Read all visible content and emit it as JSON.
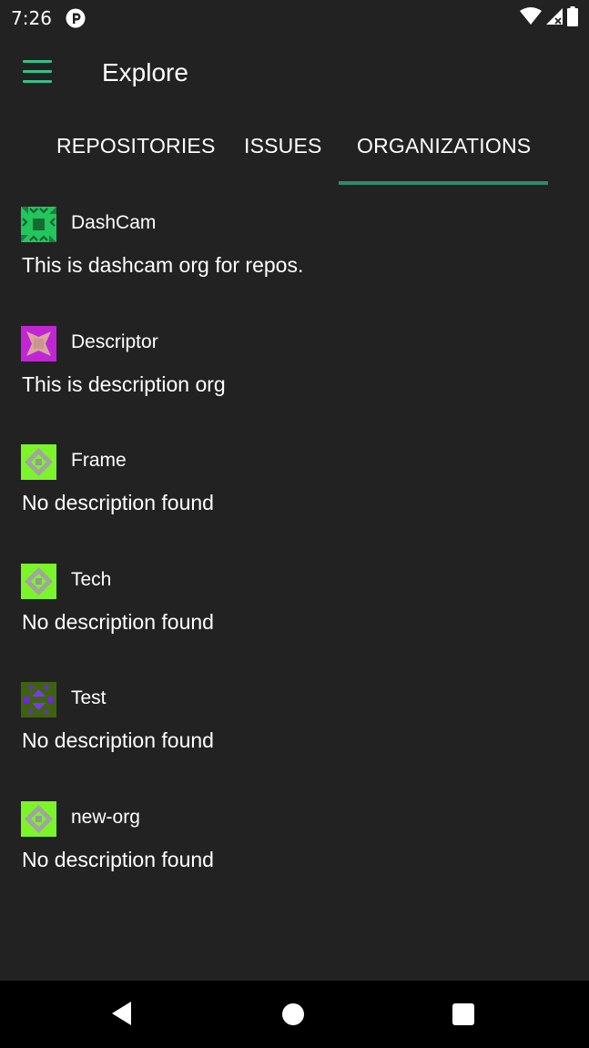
{
  "status_bar": {
    "time": "7:26",
    "app_icon": "pinterest-like-icon",
    "icons": [
      "wifi-icon",
      "signal-icon",
      "battery-icon"
    ]
  },
  "app_bar": {
    "menu_icon": "hamburger-menu-icon",
    "title": "Explore"
  },
  "tabs": [
    {
      "label": "REPOSITORIES",
      "selected": false
    },
    {
      "label": "ISSUES",
      "selected": false
    },
    {
      "label": "ORGANIZATIONS",
      "selected": true
    }
  ],
  "colors": {
    "accent": "#35c08a",
    "indicator": "#2e8b6a",
    "background": "#222222"
  },
  "organizations": [
    {
      "name": "DashCam",
      "description": "This is dashcam org for repos.",
      "avatar": "identicon-green"
    },
    {
      "name": "Descriptor",
      "description": "This is description org",
      "avatar": "identicon-magenta"
    },
    {
      "name": "Frame",
      "description": "No description found",
      "avatar": "identicon-lime"
    },
    {
      "name": "Tech",
      "description": "No description found",
      "avatar": "identicon-lime"
    },
    {
      "name": "Test",
      "description": "No description found",
      "avatar": "identicon-purple"
    },
    {
      "name": "new-org",
      "description": "No description found",
      "avatar": "identicon-lime"
    }
  ],
  "nav_bar": {
    "buttons": [
      "back-icon",
      "home-icon",
      "recents-icon"
    ]
  }
}
